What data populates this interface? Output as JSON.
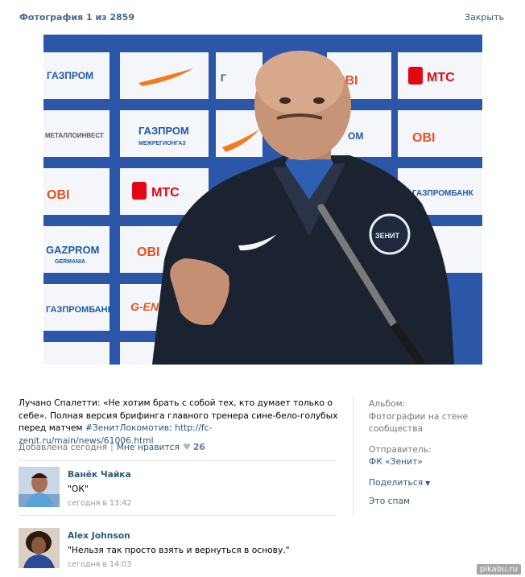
{
  "header": {
    "counter": "Фотография 1 из 2859",
    "close": "Закрыть"
  },
  "caption": {
    "text": "Лучано Спалетти: «Не хотим брать с собой тех, кто думает только о себе». Полная версия брифинга главного тренера сине-бело-голубых перед матчем ",
    "hashtag": "#ЗенитЛокомотив",
    "colon": ": ",
    "link": "http://fc-zenit.ru/main/news/61006.html"
  },
  "meta": {
    "added": "Добавлена сегодня",
    "separator": "|",
    "like_label": "Мне нравится",
    "like_count": "26"
  },
  "comments": [
    {
      "author": "Ванёк Чайка",
      "text": "\"ОК\"",
      "time": "сегодня в 13:42"
    },
    {
      "author": "Alex Johnson",
      "text": "\"Нельзя так просто взять и вернуться в основу.\"",
      "time": "сегодня в 14:03"
    }
  ],
  "sidebar": {
    "album_label": "Альбом:",
    "album_value": "Фотографии на стене сообщества",
    "sender_label": "Отправитель:",
    "sender_value": "ФК «Зенит»",
    "share": "Поделиться",
    "spam": "Это спам"
  },
  "photo_logos": {
    "gazprom": "ГАЗПРОМ",
    "gazprom_sub": "МЕЖРЕГИОНГАЗ",
    "mts": "МТС",
    "obi": "OBI",
    "metallinvest": "МЕТАЛЛОИНВЕСТ",
    "gazprom_latin": "GAZPROM",
    "gazprom_latin_sub": "GERMANIA",
    "gazprombank": "ГАЗПРОМБАНК",
    "geneva": "G-ENERGY",
    "zenit": "ЗЕНИТ"
  },
  "watermark": "pikabu.ru",
  "colors": {
    "link": "#2b587a",
    "header": "#45688e",
    "muted": "#777777",
    "backdrop_blue": "#2a4fa0",
    "jacket": "#1a1f2a"
  }
}
